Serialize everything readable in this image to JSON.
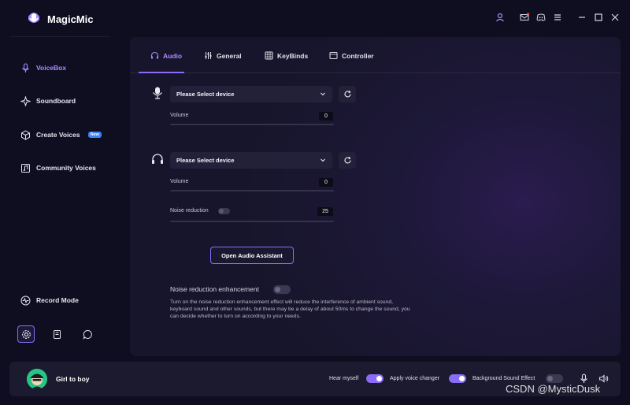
{
  "app": {
    "title": "MagicMic"
  },
  "colors": {
    "accent": "#8b6cf7",
    "accent_text": "#a98cff",
    "background": "#0f0e20",
    "panel": "#1d1838",
    "new_badge": "#3b82f6"
  },
  "titlebar": {
    "icons": [
      "user-icon",
      "mail-icon",
      "discord-icon",
      "menu-icon",
      "minimize-icon",
      "maximize-icon",
      "close-icon"
    ]
  },
  "sidebar": {
    "items": [
      {
        "label": "VoiceBox",
        "icon": "mic-icon",
        "active": true
      },
      {
        "label": "Soundboard",
        "icon": "sparkle-icon",
        "active": false
      },
      {
        "label": "Create Voices",
        "icon": "hexagon-icon",
        "badge": "New",
        "active": false
      },
      {
        "label": "Community Voices",
        "icon": "music-folder-icon",
        "active": false
      }
    ],
    "record_mode": "Record Mode",
    "bottom_icons": [
      "settings-icon",
      "book-icon",
      "chat-icon"
    ]
  },
  "tabs": [
    {
      "label": "Audio",
      "icon": "headphones-icon",
      "active": true
    },
    {
      "label": "General",
      "icon": "sliders-icon",
      "active": false
    },
    {
      "label": "KeyBinds",
      "icon": "keyboard-icon",
      "active": false
    },
    {
      "label": "Controller",
      "icon": "controller-icon",
      "active": false
    }
  ],
  "audio": {
    "microphone": {
      "select_value": "Please Select device",
      "volume_label": "Volume",
      "volume_value": "0"
    },
    "headphones": {
      "select_value": "Please Select device",
      "volume_label": "Volume",
      "volume_value": "0",
      "noise_reduction_label": "Noise reduction",
      "noise_reduction_value": "25"
    },
    "assistant_button": "Open Audio Assistant",
    "nre_label": "Noise reduction enhancement",
    "nre_description": "Turn on the noise reduction enhancement effect will reduce the interference of ambient sound, keyboard sound and other sounds, but there may be a delay of about 50ms to change the sound, you can decide whether to turn on according to your needs."
  },
  "bottombar": {
    "voice_name": "Girl to boy",
    "hear_myself": "Hear myself",
    "apply_voice_changer": "Apply voice changer",
    "background_sound_effect": "Background Sound Effect",
    "hear_myself_on": true,
    "apply_voice_changer_on": true,
    "background_sound_effect_on": false
  },
  "watermark": "CSDN @MysticDusk"
}
